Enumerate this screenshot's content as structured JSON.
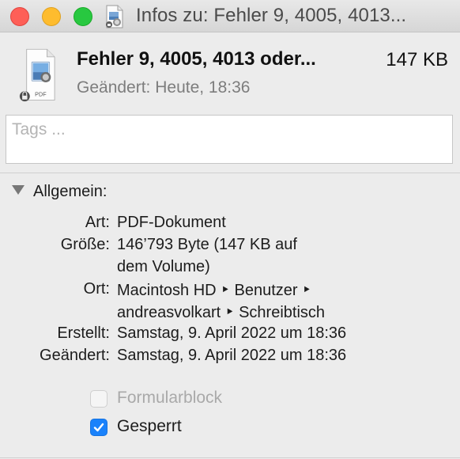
{
  "window": {
    "title": "Infos zu: Fehler 9, 4005, 4013...",
    "controls": [
      "close",
      "minimize",
      "zoom"
    ]
  },
  "file": {
    "name": "Fehler 9, 4005, 4013 oder...",
    "size": "147 KB",
    "modified": "Geändert: Heute, 18:36",
    "icon": "pdf-file-locked-icon",
    "icon_badge": "PDF"
  },
  "tags": {
    "placeholder": "Tags ...",
    "value": ""
  },
  "general": {
    "title": "Allgemein:",
    "expanded": true,
    "rows": [
      {
        "label": "Art:",
        "value_lines": [
          "PDF-Dokument"
        ]
      },
      {
        "label": "Größe:",
        "value_lines": [
          "146’793 Byte (147 KB auf",
          "dem Volume)"
        ]
      },
      {
        "label": "Ort:",
        "value_lines": [
          "Macintosh HD ‣ Benutzer ‣",
          "andreasvolkart ‣ Schreibtisch"
        ]
      },
      {
        "label": "Erstellt:",
        "value_lines": [
          "Samstag, 9. April 2022 um 18:36"
        ]
      },
      {
        "label": "Geändert:",
        "value_lines": [
          "Samstag, 9. April 2022 um 18:36"
        ]
      }
    ],
    "checkboxes": [
      {
        "label": "Formularblock",
        "checked": false,
        "enabled": false
      },
      {
        "label": "Gesperrt",
        "checked": true,
        "enabled": true
      }
    ]
  }
}
